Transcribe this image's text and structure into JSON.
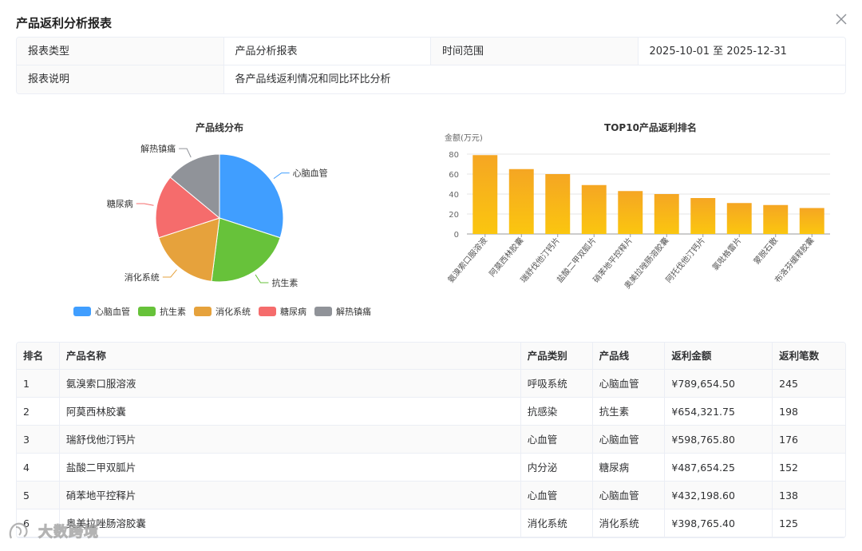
{
  "dialog": {
    "title": "产品返利分析报表"
  },
  "info": {
    "row1": [
      {
        "label": "报表类型",
        "value": "产品分析报表"
      },
      {
        "label": "时间范围",
        "value": "2025-10-01 至 2025-12-31"
      }
    ],
    "row2": {
      "label": "报表说明",
      "value": "各产品线返利情况和同比环比分析"
    }
  },
  "pie": {
    "title": "产品线分布",
    "slices": [
      {
        "name": "心脑血管",
        "value": 30,
        "color": "#409eff"
      },
      {
        "name": "抗生素",
        "value": 22,
        "color": "#67c23a"
      },
      {
        "name": "消化系统",
        "value": 18,
        "color": "#e6a23c"
      },
      {
        "name": "糖尿病",
        "value": 16,
        "color": "#f56c6c"
      },
      {
        "name": "解热镇痛",
        "value": 14,
        "color": "#909399"
      }
    ]
  },
  "chart_data": {
    "type": "bar",
    "title": "TOP10产品返利排名",
    "ylabel": "金额(万元)",
    "ylim": [
      0,
      80
    ],
    "yticks": [
      0,
      20,
      40,
      60,
      80
    ],
    "categories": [
      "氨溴索口服溶液",
      "阿莫西林胶囊",
      "瑞舒伐他汀钙片",
      "盐酸二甲双胍片",
      "硝苯地平控释片",
      "奥美拉唑肠溶胶囊",
      "阿托伐他汀钙片",
      "氯吡格雷片",
      "蒙脱石散",
      "布洛芬缓释胶囊"
    ],
    "values": [
      79,
      65,
      60,
      49,
      43,
      40,
      36,
      31,
      29,
      26
    ],
    "bar_color_top": "#f5a623",
    "bar_color_bottom": "#fbc60f",
    "grid": true
  },
  "table": {
    "headers": [
      "排名",
      "产品名称",
      "产品类别",
      "产品线",
      "返利金额",
      "返利笔数"
    ],
    "rows": [
      [
        "1",
        "氨溴索口服溶液",
        "呼吸系统",
        "心脑血管",
        "¥789,654.50",
        "245"
      ],
      [
        "2",
        "阿莫西林胶囊",
        "抗感染",
        "抗生素",
        "¥654,321.75",
        "198"
      ],
      [
        "3",
        "瑞舒伐他汀钙片",
        "心血管",
        "心脑血管",
        "¥598,765.80",
        "176"
      ],
      [
        "4",
        "盐酸二甲双胍片",
        "内分泌",
        "糖尿病",
        "¥487,654.25",
        "152"
      ],
      [
        "5",
        "硝苯地平控释片",
        "心血管",
        "心脑血管",
        "¥432,198.60",
        "138"
      ],
      [
        "6",
        "奥美拉唑肠溶胶囊",
        "消化系统",
        "消化系统",
        "¥398,765.40",
        "125"
      ]
    ]
  },
  "watermark": {
    "text": "大数跨境"
  }
}
